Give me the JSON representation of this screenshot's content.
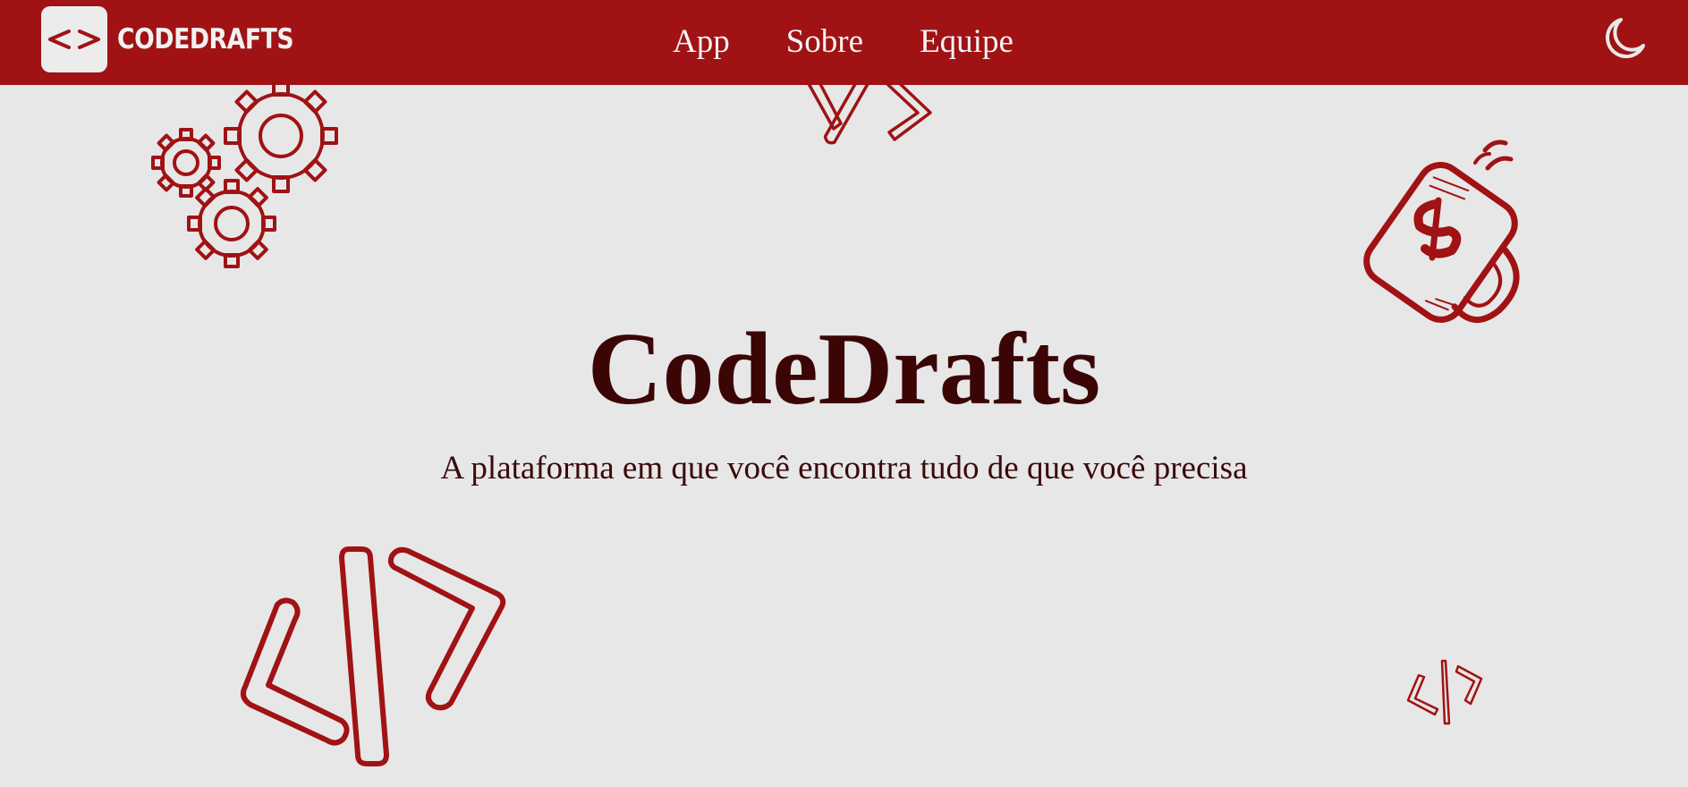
{
  "header": {
    "brand": "CODEDRAFTS",
    "logo_icon": "code-brackets-icon",
    "nav": [
      {
        "label": "App"
      },
      {
        "label": "Sobre"
      },
      {
        "label": "Equipe"
      }
    ],
    "theme_toggle_icon": "moon-icon"
  },
  "hero": {
    "title": "CodeDrafts",
    "subtitle": "A plataforma em que você encontra tudo de que você precisa"
  },
  "decorations": {
    "icons": [
      "gears-icon",
      "code-brackets-icon",
      "coffee-mug-icon",
      "code-brackets-icon",
      "code-brackets-icon"
    ]
  },
  "colors": {
    "header_bg": "#a01214",
    "accent": "#a01214",
    "page_bg": "#e7e7e7",
    "title": "#3b0506",
    "header_text": "#f3f3f3"
  }
}
